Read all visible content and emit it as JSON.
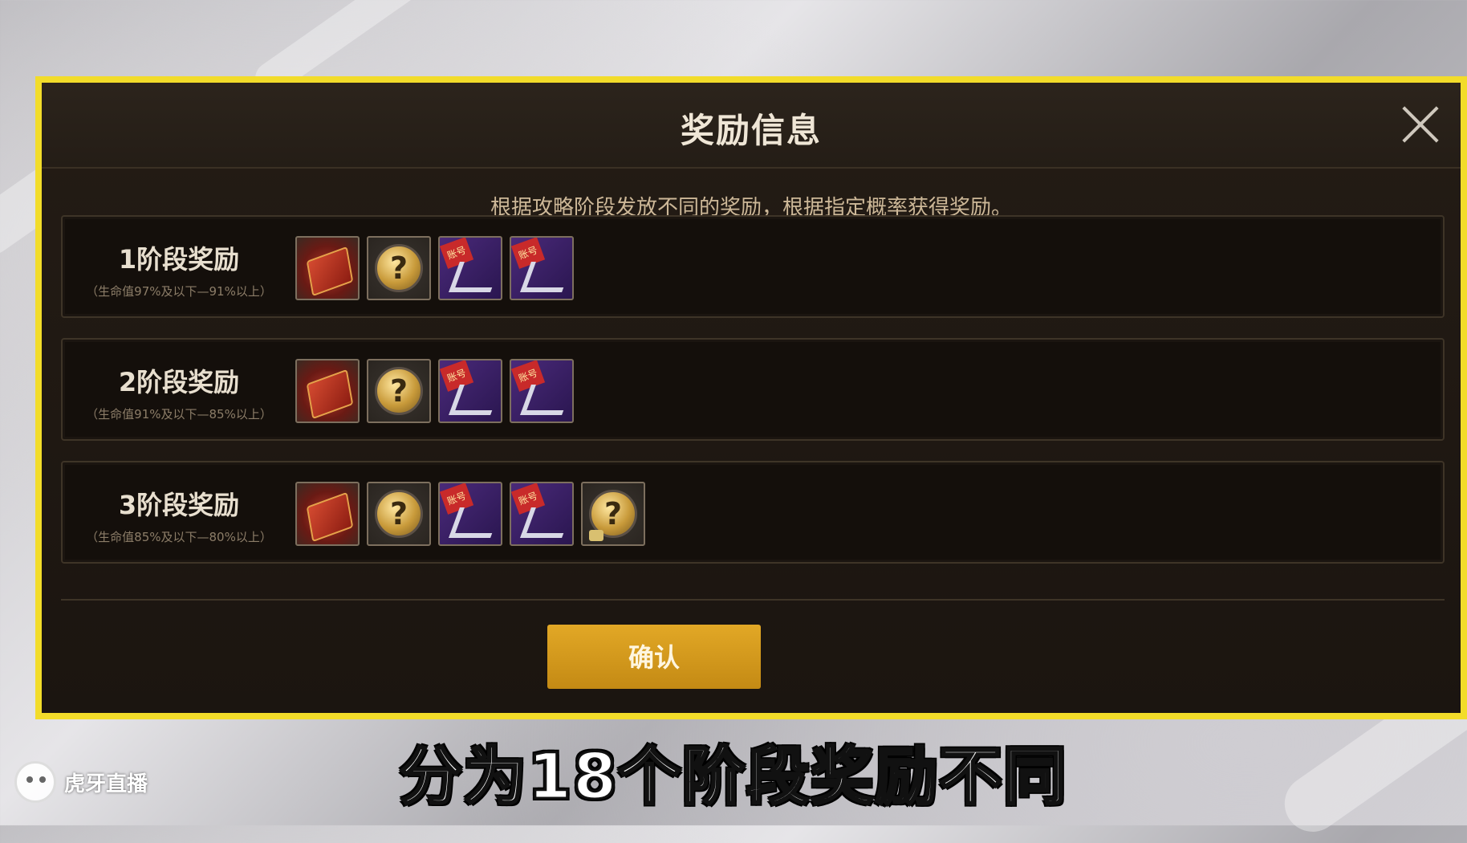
{
  "dialog": {
    "title": "奖励信息",
    "description": "根据攻略阶段发放不同的奖励，根据指定概率获得奖励。",
    "confirm_label": "确认"
  },
  "stages": [
    {
      "title": "1阶段奖励",
      "subtitle": "（生命值97%及以下—91%以上）",
      "items": [
        "red-box-icon",
        "mystery-coin-icon",
        "purple-bracket-icon",
        "purple-bracket-icon"
      ]
    },
    {
      "title": "2阶段奖励",
      "subtitle": "（生命值91%及以下—85%以上）",
      "items": [
        "red-box-icon",
        "mystery-coin-icon",
        "purple-bracket-icon",
        "purple-bracket-icon"
      ]
    },
    {
      "title": "3阶段奖励",
      "subtitle": "（生命值85%及以下—80%以上）",
      "items": [
        "red-box-icon",
        "mystery-coin-icon",
        "purple-bracket-icon",
        "purple-bracket-icon",
        "mystery-coin-puzzle-icon"
      ]
    }
  ],
  "item_tag": "账号",
  "caption": "分为18个阶段奖励不同",
  "watermark": "虎牙直播"
}
